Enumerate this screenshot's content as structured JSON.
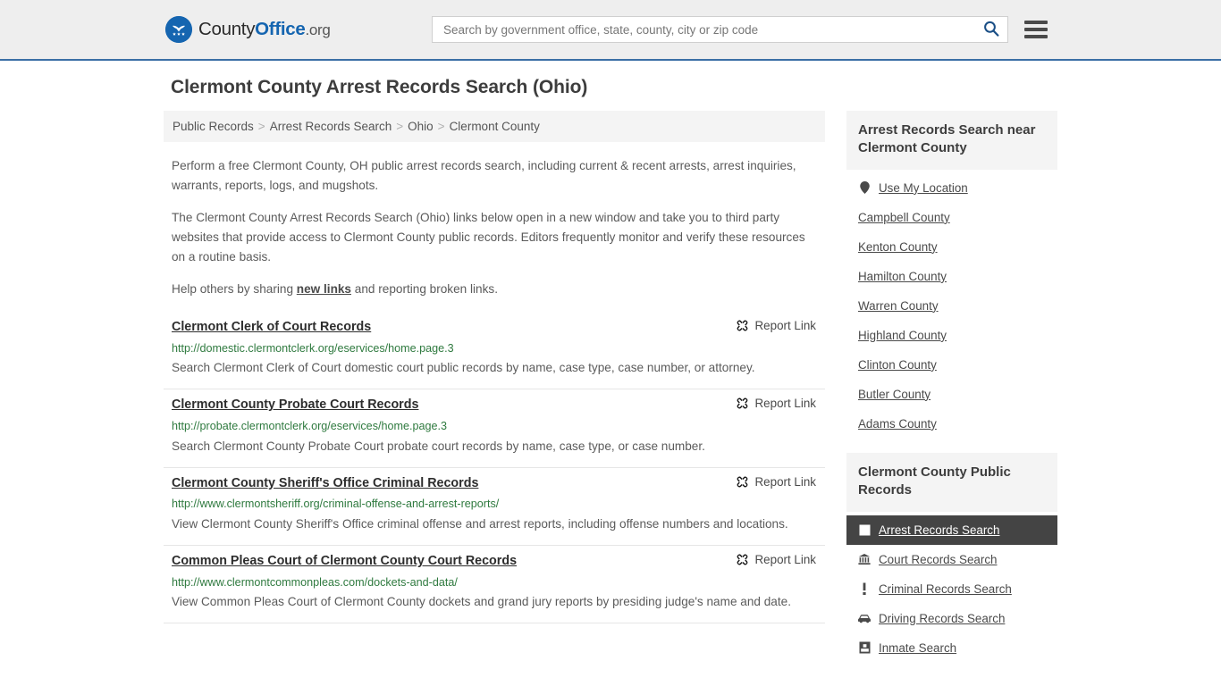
{
  "header": {
    "logo": {
      "part1": "County",
      "part2": "Office",
      "part3": ".org",
      "icon": "eagle-seal-icon"
    },
    "search": {
      "placeholder": "Search by government office, state, county, city or zip code",
      "value": "",
      "icon": "search-icon"
    },
    "menu_icon": "hamburger-menu-icon"
  },
  "page": {
    "title": "Clermont County Arrest Records Search (Ohio)"
  },
  "breadcrumb": {
    "separator": ">",
    "items": [
      {
        "label": "Public Records",
        "current": false
      },
      {
        "label": "Arrest Records Search",
        "current": false
      },
      {
        "label": "Ohio",
        "current": false
      },
      {
        "label": "Clermont County",
        "current": true
      }
    ]
  },
  "intro": {
    "p1": "Perform a free Clermont County, OH public arrest records search, including current & recent arrests, arrest inquiries, warrants, reports, logs, and mugshots.",
    "p2": "The Clermont County Arrest Records Search (Ohio) links below open in a new window and take you to third party websites that provide access to Clermont County public records. Editors frequently monitor and verify these resources on a routine basis.",
    "p3_before": "Help others by sharing ",
    "p3_link": "new links",
    "p3_after": " and reporting broken links."
  },
  "report_link_label": "Report Link",
  "report_link_icon": "broken-link-icon",
  "results": [
    {
      "title": "Clermont Clerk of Court Records",
      "url": "http://domestic.clermontclerk.org/eservices/home.page.3",
      "description": "Search Clermont Clerk of Court domestic court public records by name, case type, case number, or attorney."
    },
    {
      "title": "Clermont County Probate Court Records",
      "url": "http://probate.clermontclerk.org/eservices/home.page.3",
      "description": "Search Clermont County Probate Court probate court records by name, case type, or case number."
    },
    {
      "title": "Clermont County Sheriff's Office Criminal Records",
      "url": "http://www.clermontsheriff.org/criminal-offense-and-arrest-reports/",
      "description": "View Clermont County Sheriff's Office criminal offense and arrest reports, including offense numbers and locations."
    },
    {
      "title": "Common Pleas Court of Clermont County Court Records",
      "url": "http://www.clermontcommonpleas.com/dockets-and-data/",
      "description": "View Common Pleas Court of Clermont County dockets and grand jury reports by presiding judge's name and date."
    }
  ],
  "sidebar": {
    "nearby": {
      "heading": "Arrest Records Search near Clermont County",
      "items": [
        {
          "label": "Use My Location",
          "icon": "map-pin-icon",
          "active": false
        },
        {
          "label": "Campbell County",
          "icon": "",
          "active": false
        },
        {
          "label": "Kenton County",
          "icon": "",
          "active": false
        },
        {
          "label": "Hamilton County",
          "icon": "",
          "active": false
        },
        {
          "label": "Warren County",
          "icon": "",
          "active": false
        },
        {
          "label": "Highland County",
          "icon": "",
          "active": false
        },
        {
          "label": "Clinton County",
          "icon": "",
          "active": false
        },
        {
          "label": "Butler County",
          "icon": "",
          "active": false
        },
        {
          "label": "Adams County",
          "icon": "",
          "active": false
        }
      ]
    },
    "public_records": {
      "heading": "Clermont County Public Records",
      "items": [
        {
          "label": "Arrest Records Search",
          "icon": "arrest-square-icon",
          "active": true
        },
        {
          "label": "Court Records Search",
          "icon": "courthouse-icon",
          "active": false
        },
        {
          "label": "Criminal Records Search",
          "icon": "exclamation-icon",
          "active": false
        },
        {
          "label": "Driving Records Search",
          "icon": "car-icon",
          "active": false
        },
        {
          "label": "Inmate Search",
          "icon": "inmate-icon",
          "active": false
        }
      ]
    }
  },
  "colors": {
    "brand_blue": "#1565b0",
    "header_bg": "#eeeeee",
    "header_border": "#3a6ea5",
    "panel_bg": "#f4f4f4",
    "active_bg": "#444444",
    "url_green": "#2f7a3f",
    "body_text": "#5b5b5b"
  }
}
